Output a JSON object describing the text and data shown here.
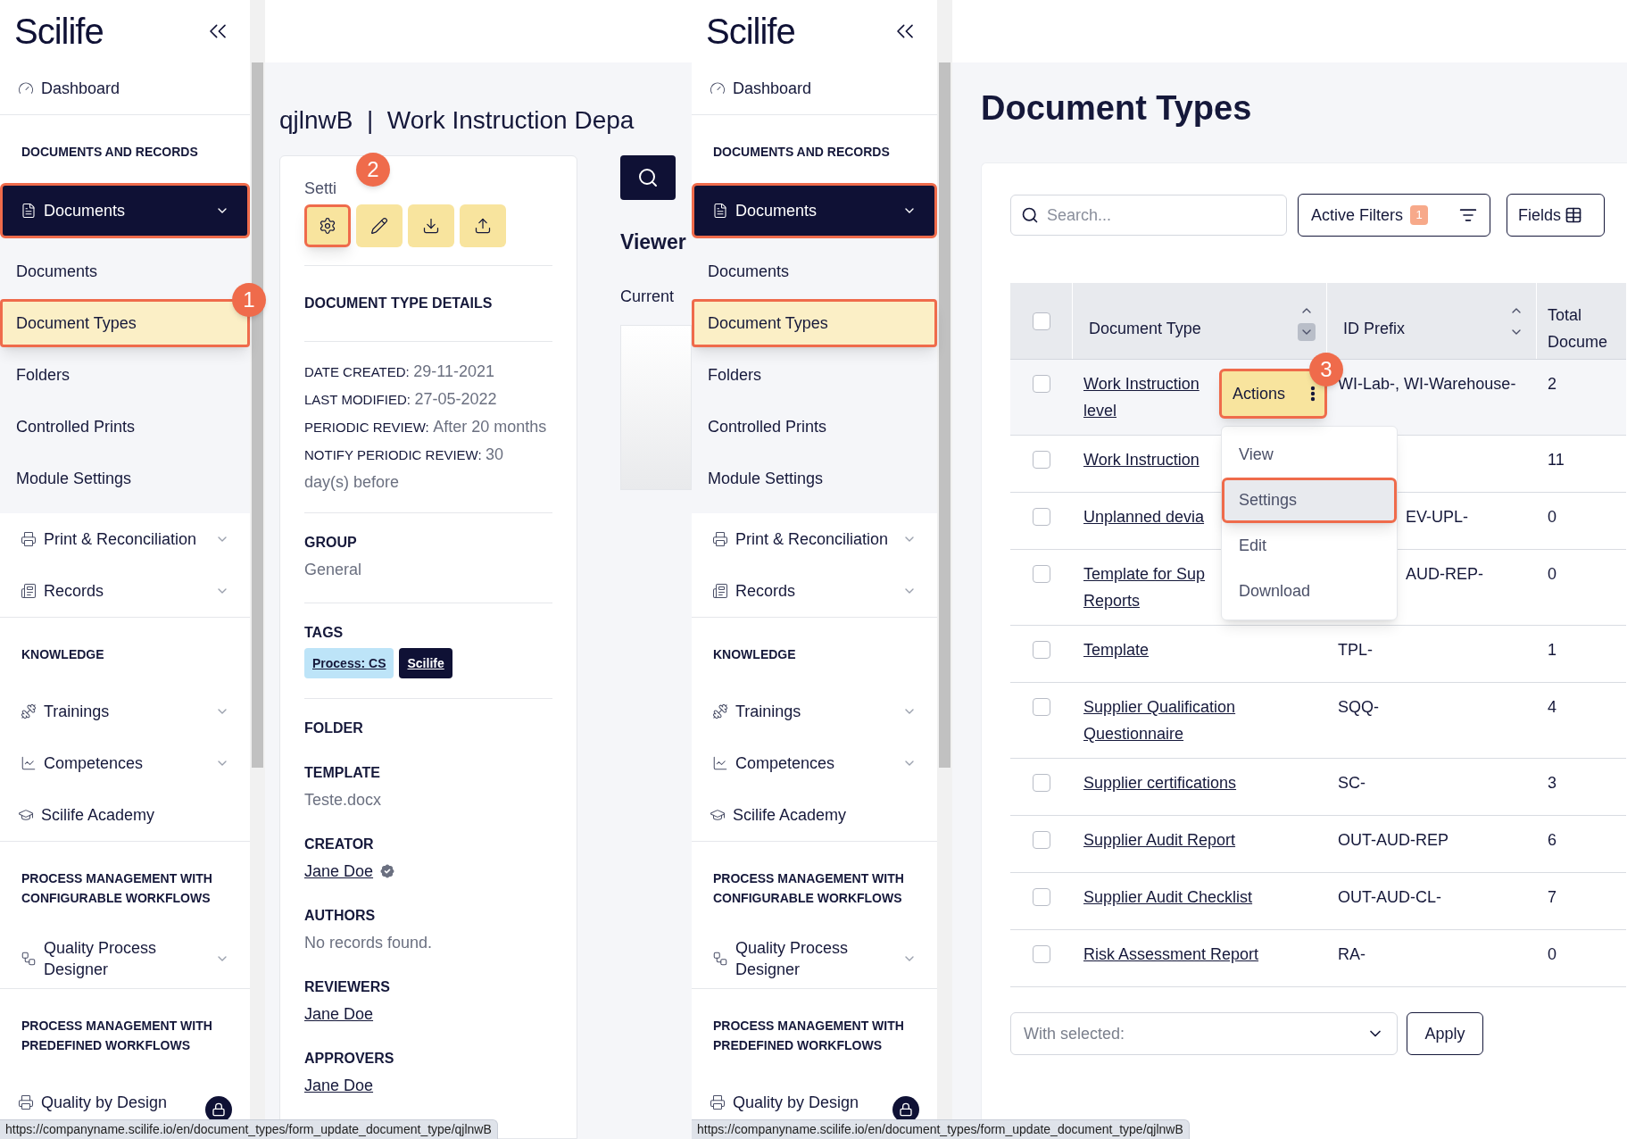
{
  "left_screen": {
    "sidebar": {
      "logo": "Scilife",
      "items": [
        {
          "kind": "link",
          "label": "Dashboard"
        },
        {
          "kind": "section",
          "label": "DOCUMENTS AND RECORDS"
        },
        {
          "kind": "menu",
          "label": "Documents",
          "selected": true,
          "highlighted": true,
          "children": [
            {
              "label": "Documents",
              "selected": false,
              "highlighted": false
            },
            {
              "label": "Document Types",
              "selected": true,
              "highlighted": true,
              "callout": "1"
            },
            {
              "label": "Folders",
              "selected": false,
              "highlighted": false
            },
            {
              "label": "Controlled Prints",
              "selected": false,
              "highlighted": false
            },
            {
              "label": "Module Settings",
              "selected": false,
              "highlighted": false
            }
          ]
        },
        {
          "kind": "menu",
          "label": "Print & Reconciliation",
          "selected": false,
          "highlighted": false
        },
        {
          "kind": "menu",
          "label": "Records",
          "selected": false,
          "highlighted": false
        },
        {
          "kind": "section",
          "label": "KNOWLEDGE"
        },
        {
          "kind": "menu",
          "label": "Trainings",
          "selected": false,
          "highlighted": false
        },
        {
          "kind": "menu",
          "label": "Competences",
          "selected": false,
          "highlighted": false
        },
        {
          "kind": "link",
          "label": "Scilife Academy"
        },
        {
          "kind": "section",
          "label": "PROCESS MANAGEMENT WITH CONFIGURABLE WORKFLOWS"
        },
        {
          "kind": "menu",
          "label": "Quality Process Designer",
          "selected": false,
          "highlighted": false
        },
        {
          "kind": "section",
          "label": "PROCESS MANAGEMENT WITH PREDEFINED WORKFLOWS"
        },
        {
          "kind": "link",
          "label": "Quality by Design",
          "locked": true
        }
      ]
    },
    "title": "qjlnwB  |  Work Instruction Depa",
    "toolbar_label": "Setti",
    "tools": [
      {
        "highlighted": true,
        "callout": "2"
      },
      {
        "highlighted": false
      },
      {
        "highlighted": false
      },
      {
        "highlighted": false
      }
    ],
    "heading": "DOCUMENT TYPE DETAILS",
    "facts": [
      {
        "label": "DATE CREATED:",
        "value": "29-11-2021"
      },
      {
        "label": "LAST MODIFIED:",
        "value": "27-05-2022"
      },
      {
        "label": "PERIODIC REVIEW:",
        "value": "After 20 months"
      },
      {
        "label": "NOTIFY PERIODIC REVIEW:",
        "value": "30 day(s) before"
      }
    ],
    "field_groups": [
      [
        {
          "label": "GROUP",
          "kind": "text",
          "value": "General"
        }
      ],
      [
        {
          "label": "TAGS",
          "kind": "tags",
          "tags": [
            {
              "label": "Process: CS",
              "color": "#bde4f8"
            },
            {
              "label": "Scilife",
              "color": "#0f1135"
            }
          ]
        }
      ],
      [
        {
          "label": "FOLDER",
          "kind": "empty"
        },
        {
          "label": "TEMPLATE",
          "kind": "text",
          "value": "Teste.docx"
        },
        {
          "label": "CREATOR",
          "kind": "person",
          "value": "Jane Doe",
          "verified": true
        },
        {
          "label": "AUTHORS",
          "kind": "text",
          "value": "No records found."
        },
        {
          "label": "REVIEWERS",
          "kind": "person",
          "value": "Jane Doe",
          "verified": false
        },
        {
          "label": "APPROVERS",
          "kind": "person",
          "value": "Jane Doe",
          "verified": false
        }
      ]
    ],
    "viewer_heading": "Viewer",
    "viewer_label": "Current",
    "status_url": "https://companyname.scilife.io/en/document_types/form_update_document_type/qjlnwB"
  },
  "right_screen": {
    "sidebar": {
      "logo": "Scilife",
      "items": [
        {
          "kind": "link",
          "label": "Dashboard"
        },
        {
          "kind": "section",
          "label": "DOCUMENTS AND RECORDS"
        },
        {
          "kind": "menu",
          "label": "Documents",
          "selected": true,
          "highlighted": true,
          "children": [
            {
              "label": "Documents",
              "selected": false,
              "highlighted": false
            },
            {
              "label": "Document Types",
              "selected": true,
              "highlighted": true
            },
            {
              "label": "Folders",
              "selected": false,
              "highlighted": false
            },
            {
              "label": "Controlled Prints",
              "selected": false,
              "highlighted": false
            },
            {
              "label": "Module Settings",
              "selected": false,
              "highlighted": false
            }
          ]
        },
        {
          "kind": "menu",
          "label": "Print & Reconciliation",
          "selected": false,
          "highlighted": false
        },
        {
          "kind": "menu",
          "label": "Records",
          "selected": false,
          "highlighted": false
        },
        {
          "kind": "section",
          "label": "KNOWLEDGE"
        },
        {
          "kind": "menu",
          "label": "Trainings",
          "selected": false,
          "highlighted": false
        },
        {
          "kind": "menu",
          "label": "Competences",
          "selected": false,
          "highlighted": false
        },
        {
          "kind": "link",
          "label": "Scilife Academy"
        },
        {
          "kind": "section",
          "label": "PROCESS MANAGEMENT WITH CONFIGURABLE WORKFLOWS"
        },
        {
          "kind": "menu",
          "label": "Quality Process Designer",
          "selected": false,
          "highlighted": false
        },
        {
          "kind": "section",
          "label": "PROCESS MANAGEMENT WITH PREDEFINED WORKFLOWS"
        },
        {
          "kind": "link",
          "label": "Quality by Design",
          "locked": true
        }
      ]
    },
    "title": "Document Types",
    "search": {
      "placeholder": "Search..."
    },
    "filters_button": {
      "label": "Active Filters",
      "count": "1"
    },
    "fields_button": {
      "label": "Fields"
    },
    "table": {
      "select_all": {
        "checked": false
      },
      "columns": [
        {
          "label": "Document Type",
          "sorted": true
        },
        {
          "label": "ID Prefix",
          "sorted": false
        },
        {
          "label": "Total Docume"
        }
      ],
      "rows": [
        {
          "checked": false,
          "name": "Work Instruction level",
          "id_prefix": "WI-Lab-, WI-Warehouse-",
          "total": "2",
          "actions": {
            "label": "Actions",
            "highlighted": true,
            "callout": "3",
            "items": [
              {
                "label": "View",
                "selected": false
              },
              {
                "label": "Settings",
                "selected": true
              },
              {
                "label": "Edit",
                "selected": false
              },
              {
                "label": "Download",
                "selected": false
              }
            ]
          }
        },
        {
          "checked": false,
          "name": "Work Instruction",
          "total": "11"
        },
        {
          "checked": false,
          "name": "Unplanned devia",
          "id_prefix": "EV-UPL-",
          "total": "0"
        },
        {
          "checked": false,
          "name": "Template for Sup Reports",
          "id_prefix": "AUD-REP-",
          "total": "0"
        },
        {
          "checked": false,
          "name": "Template",
          "id_prefix": "TPL-",
          "total": "1"
        },
        {
          "checked": false,
          "name": "Supplier Qualification Questionnaire",
          "id_prefix": "SQQ-",
          "total": "4"
        },
        {
          "checked": false,
          "name": "Supplier certifications",
          "id_prefix": "SC-",
          "total": "3"
        },
        {
          "checked": false,
          "name": "Supplier Audit Report",
          "id_prefix": "OUT-AUD-REP",
          "total": "6"
        },
        {
          "checked": false,
          "name": "Supplier Audit Checklist",
          "id_prefix": "OUT-AUD-CL-",
          "total": "7"
        },
        {
          "checked": false,
          "name": "Risk Assessment Report",
          "id_prefix": "RA-",
          "total": "0"
        }
      ]
    },
    "bulk_select": {
      "placeholder": "With selected:"
    },
    "apply_button": "Apply",
    "status_url": "https://companyname.scilife.io/en/document_types/form_update_document_type/qjlnwB"
  }
}
